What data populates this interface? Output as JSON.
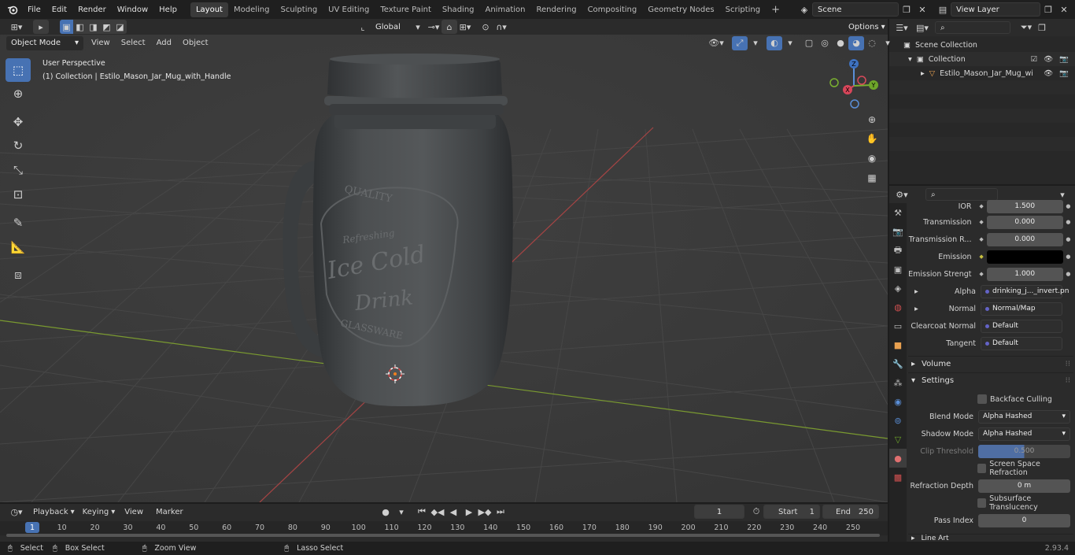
{
  "menu": [
    "File",
    "Edit",
    "Render",
    "Window",
    "Help"
  ],
  "workspaces": [
    "Layout",
    "Modeling",
    "Sculpting",
    "UV Editing",
    "Texture Paint",
    "Shading",
    "Animation",
    "Rendering",
    "Compositing",
    "Geometry Nodes",
    "Scripting"
  ],
  "scene_name": "Scene",
  "view_layer": "View Layer",
  "viewport": {
    "mode": "Object Mode",
    "menus": [
      "View",
      "Select",
      "Add",
      "Object"
    ],
    "transform_orientation": "Global",
    "options_label": "Options",
    "perspective_label": "User Perspective",
    "collection_label": "(1) Collection | Estilo_Mason_Jar_Mug_with_Handle",
    "jar_text": [
      "QUALITY",
      "Refreshing",
      "Ice Cold",
      "Drink",
      "GLASSWARE"
    ],
    "axes": {
      "x": "X",
      "y": "Y",
      "z": "Z"
    }
  },
  "outliner": {
    "rows": [
      "Scene Collection",
      "Collection",
      "Estilo_Mason_Jar_Mug_wi"
    ]
  },
  "properties": {
    "rows": [
      {
        "label": "IOR",
        "value": "1.500",
        "kind": "num"
      },
      {
        "label": "Transmission",
        "value": "0.000",
        "kind": "num"
      },
      {
        "label": "Transmission R...",
        "value": "0.000",
        "kind": "num"
      },
      {
        "label": "Emission",
        "value": "",
        "kind": "color"
      },
      {
        "label": "Emission Strengt",
        "value": "1.000",
        "kind": "num"
      },
      {
        "label": "Alpha",
        "value": "drinking_j..._invert.pn",
        "kind": "link"
      },
      {
        "label": "Normal",
        "value": "Normal/Map",
        "kind": "link"
      },
      {
        "label": "Clearcoat Normal",
        "value": "Default",
        "kind": "link"
      },
      {
        "label": "Tangent",
        "value": "Default",
        "kind": "link"
      }
    ],
    "section_volume": "Volume",
    "section_settings": "Settings",
    "backface_culling": "Backface Culling",
    "blend_mode_label": "Blend Mode",
    "blend_mode": "Alpha Hashed",
    "shadow_mode_label": "Shadow Mode",
    "shadow_mode": "Alpha Hashed",
    "clip_threshold_label": "Clip Threshold",
    "clip_threshold": "0.500",
    "screen_space_refraction": "Screen Space Refraction",
    "refraction_depth_label": "Refraction Depth",
    "refraction_depth": "0 m",
    "subsurface_translucency": "Subsurface Translucency",
    "pass_index_label": "Pass Index",
    "pass_index": "0",
    "line_art": "Line Art"
  },
  "timeline": {
    "menus": [
      "Playback",
      "Keying",
      "View",
      "Marker"
    ],
    "current_frame": "1",
    "start_label": "Start",
    "start": "1",
    "end_label": "End",
    "end": "250",
    "ticks": [
      "1",
      "10",
      "20",
      "30",
      "40",
      "50",
      "60",
      "70",
      "80",
      "90",
      "100",
      "110",
      "120",
      "130",
      "140",
      "150",
      "160",
      "170",
      "180",
      "190",
      "200",
      "210",
      "220",
      "230",
      "240",
      "250"
    ]
  },
  "status": {
    "select": "Select",
    "box_select": "Box Select",
    "zoom_view": "Zoom View",
    "lasso_select": "Lasso Select",
    "version": "2.93.4"
  }
}
